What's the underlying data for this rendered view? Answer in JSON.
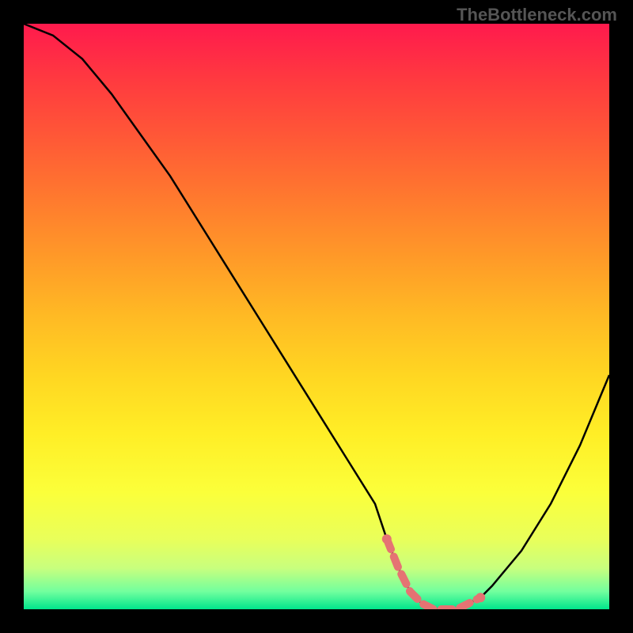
{
  "watermark": "TheBottleneck.com",
  "chart_data": {
    "type": "line",
    "title": "",
    "xlabel": "",
    "ylabel": "",
    "xlim": [
      0,
      100
    ],
    "ylim": [
      0,
      100
    ],
    "x": [
      0,
      5,
      10,
      15,
      20,
      25,
      30,
      35,
      40,
      45,
      50,
      55,
      60,
      62,
      64,
      66,
      68,
      70,
      72,
      74,
      76,
      78,
      80,
      85,
      90,
      95,
      100
    ],
    "values": [
      100,
      98,
      94,
      88,
      81,
      74,
      66,
      58,
      50,
      42,
      34,
      26,
      18,
      12,
      7,
      3,
      1,
      0,
      0,
      0,
      1,
      2,
      4,
      10,
      18,
      28,
      40
    ],
    "background_gradient_scale": {
      "top_value": 100,
      "top_color": "#ff1a4d",
      "bottom_value": 0,
      "bottom_color": "#00e58c"
    },
    "marker_points_x": [
      62,
      64,
      66,
      68,
      70,
      72,
      74,
      76,
      78
    ],
    "marker_color": "#e57373",
    "grid": false
  }
}
